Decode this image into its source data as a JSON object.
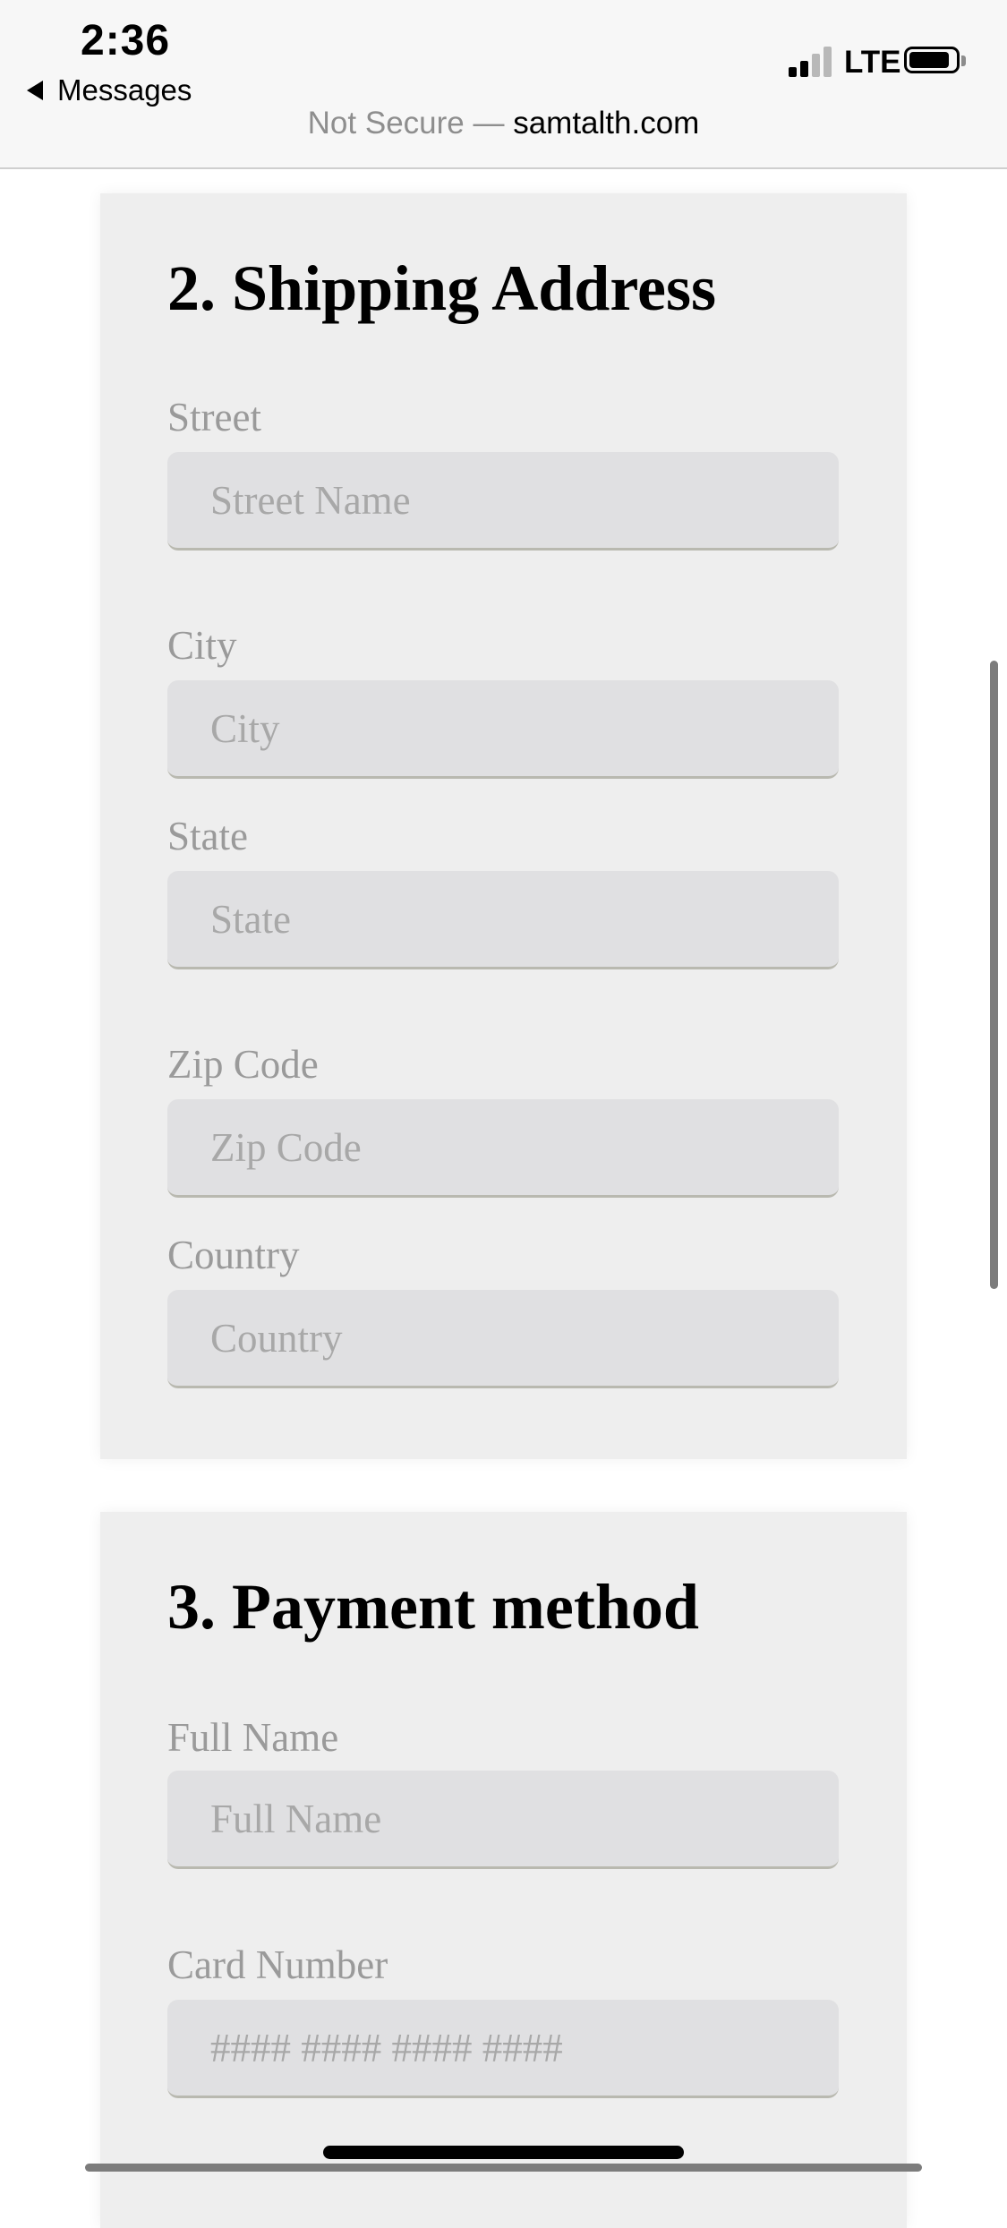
{
  "status_bar": {
    "time": "2:36",
    "back_label": "Messages",
    "network": "LTE"
  },
  "address_bar": {
    "security": "Not Secure —",
    "domain": "samtalth.com"
  },
  "shipping": {
    "title": "2. Shipping Address",
    "fields": [
      {
        "label": "Street",
        "placeholder": "Street Name"
      },
      {
        "label": "City",
        "placeholder": "City"
      },
      {
        "label": "State",
        "placeholder": "State"
      },
      {
        "label": "Zip Code",
        "placeholder": "Zip Code"
      },
      {
        "label": "Country",
        "placeholder": "Country"
      }
    ]
  },
  "payment": {
    "title": "3. Payment method",
    "fields": [
      {
        "label": "Full Name",
        "placeholder": "Full Name"
      },
      {
        "label": "Card Number",
        "placeholder": "#### #### #### ####"
      }
    ]
  }
}
